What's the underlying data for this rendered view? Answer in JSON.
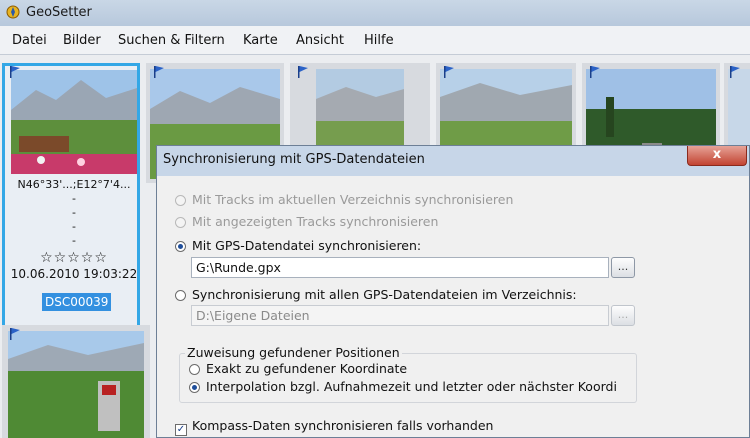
{
  "app": {
    "title": "GeoSetter",
    "icon": "geosetter-icon"
  },
  "menu": [
    "Datei",
    "Bilder",
    "Suchen & Filtern",
    "Karte",
    "Ansicht",
    "Hilfe"
  ],
  "thumbnail": {
    "coords": "N46°33'...;E12°7'4...",
    "dashes": [
      "-",
      "-",
      "-",
      "-"
    ],
    "rating_stars": "☆☆☆☆☆",
    "rating_value": 0,
    "datetime": "10.06.2010 19:03:22",
    "filename": "DSC00039"
  },
  "dialog": {
    "title": "Synchronisierung mit GPS-Datendateien",
    "close_label": "x",
    "options": {
      "tracks_dir": "Mit Tracks im aktuellen Verzeichnis synchronisieren",
      "tracks_shown": "Mit angezeigten Tracks synchronisieren",
      "gps_file": "Mit GPS-Datendatei synchronisieren:",
      "all_files": "Synchronisierung mit allen GPS-Datendateien im Verzeichnis:"
    },
    "gps_file_value": "G:\\Runde.gpx",
    "dir_value": "D:\\Eigene Dateien",
    "browse_label": "...",
    "assign_group": {
      "label": "Zuweisung gefundener Positionen",
      "exact": "Exakt zu gefundener Koordinate",
      "interpolate": "Interpolation bzgl. Aufnahmezeit und letzter oder nächster Koordi"
    },
    "compass": "Kompass-Daten synchronisieren falls vorhanden"
  },
  "colors": {
    "selection": "#33a7e6",
    "caption_bg": "#3390e0",
    "close": "#c24432"
  }
}
